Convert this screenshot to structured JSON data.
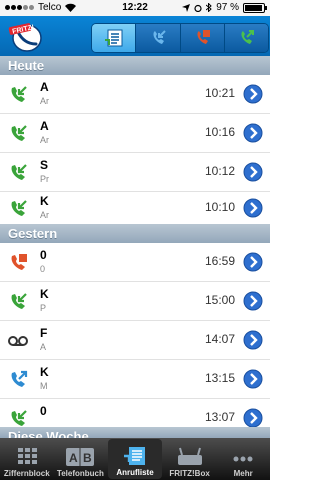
{
  "status_bar": {
    "carrier": "Telco",
    "time": "12:22",
    "battery": "97 %",
    "battery_level": 0.97
  },
  "header": {
    "logo_text": "FRITZ!"
  },
  "sections": [
    {
      "title": "Heute",
      "calls": [
        {
          "type": "incoming",
          "name": "A",
          "sub": "Ar",
          "time": "10:21"
        },
        {
          "type": "incoming",
          "name": "A",
          "sub": "Ar",
          "time": "10:16"
        },
        {
          "type": "incoming",
          "name": "S",
          "sub": "Pr",
          "time": "10:12"
        },
        {
          "type": "incoming",
          "name": "K",
          "sub": "Ar",
          "time": "10:10"
        }
      ]
    },
    {
      "title": "Gestern",
      "calls": [
        {
          "type": "missed",
          "name": "0",
          "sub": "0",
          "time": "16:59"
        },
        {
          "type": "incoming",
          "name": "K",
          "sub": "P",
          "time": "15:00"
        },
        {
          "type": "voicemail",
          "name": "F",
          "sub": "A",
          "time": "14:07"
        },
        {
          "type": "outgoing",
          "name": "K",
          "sub": "M",
          "time": "13:15"
        },
        {
          "type": "incoming",
          "name": "0",
          "sub": "",
          "time": "13:07"
        }
      ]
    },
    {
      "title": "Diese Woche",
      "calls": []
    }
  ],
  "tabs": [
    {
      "label": "Ziffernblock",
      "icon": "keypad-icon"
    },
    {
      "label": "Telefonbuch",
      "icon": "phonebook-icon"
    },
    {
      "label": "Anrufliste",
      "icon": "call-list-icon",
      "active": true
    },
    {
      "label": "FRITZ!Box",
      "icon": "router-icon"
    },
    {
      "label": "Mehr",
      "icon": "more-icon"
    }
  ],
  "colors": {
    "incoming": "#3aa43a",
    "missed": "#e0532b",
    "outgoing": "#2e8bd1",
    "header": "#0a77c9"
  }
}
